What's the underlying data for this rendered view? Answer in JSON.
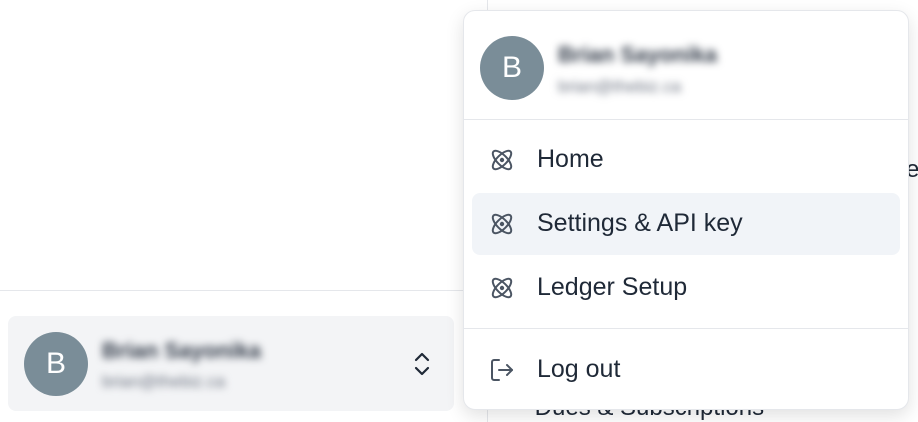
{
  "sidebar": {
    "account": {
      "avatar_initial": "B",
      "name": "Brian Sayonika",
      "email": "brian@thebiz.ca"
    }
  },
  "background": {
    "fragment_e": "e",
    "dues_item": "· Dues & Subscriptions"
  },
  "menu": {
    "profile": {
      "avatar_initial": "B",
      "name": "Brian Sayonika",
      "email": "brian@thebiz.ca"
    },
    "items": [
      {
        "label": "Home",
        "icon": "atom-icon"
      },
      {
        "label": "Settings & API key",
        "icon": "atom-icon",
        "active": true
      },
      {
        "label": "Ledger Setup",
        "icon": "atom-icon"
      }
    ],
    "logout_label": "Log out"
  },
  "colors": {
    "avatar": "#7a8d98",
    "active_item": "#f1f4f8",
    "icon": "#4b5563"
  }
}
